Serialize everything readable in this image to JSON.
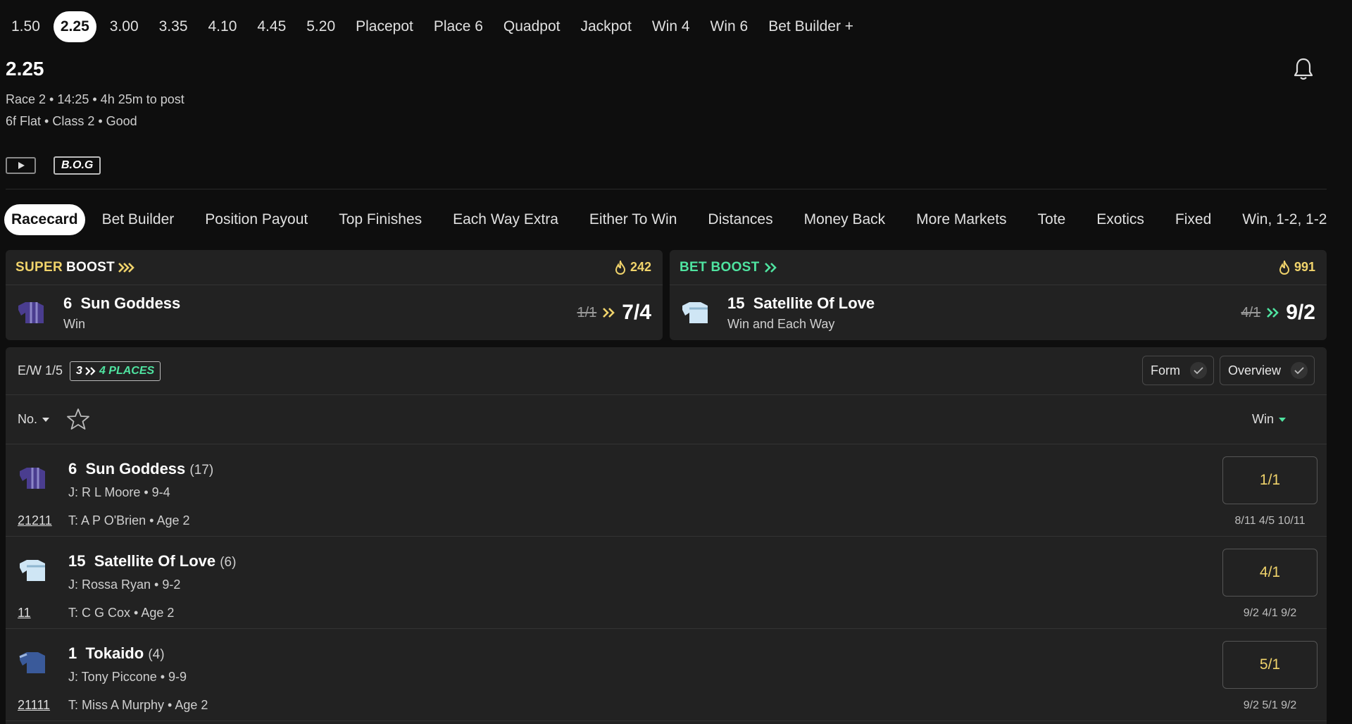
{
  "race_tabs": [
    "1.50",
    "2.25",
    "3.00",
    "3.35",
    "4.10",
    "4.45",
    "5.20",
    "Placepot",
    "Place 6",
    "Quadpot",
    "Jackpot",
    "Win 4",
    "Win 6",
    "Bet Builder +"
  ],
  "race_tabs_active": 1,
  "header": {
    "title": "2.25",
    "meta1": "Race 2 • 14:25 • 4h 25m to post",
    "meta2": "6f Flat  • Class 2  • Good",
    "bog": "B.O.G"
  },
  "market_tabs": [
    "Racecard",
    "Bet Builder",
    "Position Payout",
    "Top Finishes",
    "Each Way Extra",
    "Either To Win",
    "Distances",
    "Money Back",
    "More Markets",
    "Tote",
    "Exotics",
    "Fixed",
    "Win, 1-2, 1-2"
  ],
  "market_tabs_active": 0,
  "boosts": [
    {
      "label_part1": "SUPER",
      "label_part2": "BOOST",
      "count": "242",
      "number": "6",
      "name": "Sun Goddess",
      "market": "Win",
      "old_odds": "1/1",
      "new_odds": "7/4",
      "accent": "#f0d36b",
      "silk_color": "#4a3d8f"
    },
    {
      "label_part1": "BET BOOST",
      "label_part2": "",
      "count": "991",
      "number": "15",
      "name": "Satellite Of Love",
      "market": "Win and Each Way",
      "old_odds": "4/1",
      "new_odds": "9/2",
      "accent": "#4fe3a0",
      "silk_color": "#cfe6f5"
    }
  ],
  "panel": {
    "ew_terms": "E/W 1/5",
    "places_old": "3",
    "places_new": "4 PLACES",
    "form_toggle": "Form",
    "overview_toggle": "Overview",
    "col_no": "No.",
    "col_win": "Win"
  },
  "runners": [
    {
      "number": "6",
      "name": "Sun Goddess",
      "draw": "(17)",
      "jockey": "J: R L Moore • 9-4",
      "form": "21211",
      "trainer": "T: A P O'Brien • Age 2",
      "odds": "1/1",
      "history": "8/11  4/5  10/11",
      "silk_color": "#4a3d8f"
    },
    {
      "number": "15",
      "name": "Satellite Of Love",
      "draw": "(6)",
      "jockey": "J: Rossa Ryan • 9-2",
      "form": "11",
      "trainer": "T: C G Cox • Age 2",
      "odds": "4/1",
      "history": "9/2  4/1  9/2",
      "silk_color": "#cfe6f5"
    },
    {
      "number": "1",
      "name": "Tokaido",
      "draw": "(4)",
      "jockey": "J: Tony Piccone • 9-9",
      "form": "21111",
      "trainer": "T: Miss A Murphy  • Age 2",
      "odds": "5/1",
      "history": "9/2  5/1  9/2",
      "silk_color": "#3a5a9a"
    }
  ]
}
